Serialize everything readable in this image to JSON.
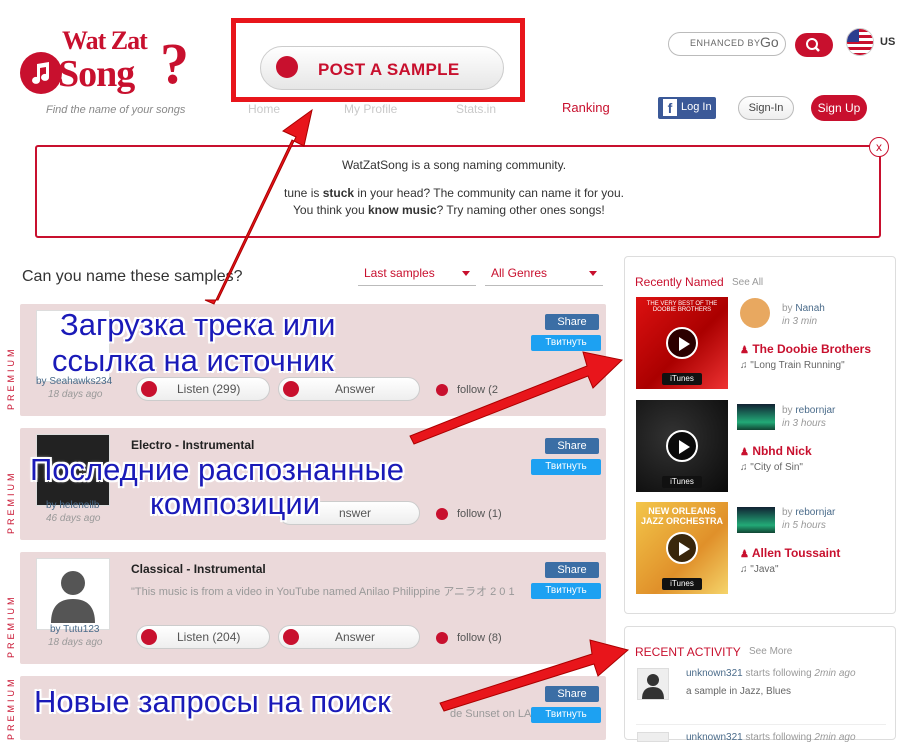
{
  "header": {
    "logo_line1": "Wat Zat",
    "logo_line2": "Song",
    "logo_q": "?",
    "tagline": "Find the name of your songs",
    "post_sample": "POST A SAMPLE",
    "nav": [
      "Home",
      "My Profile",
      "Stats.in"
    ],
    "ranking": "Ranking",
    "search_placeholder": "ENHANCED BY",
    "search_brand": "Go",
    "country": "US",
    "fb_login": "Log In",
    "sign_in": "Sign-In",
    "sign_up": "Sign Up"
  },
  "banner": {
    "line1": "WatZatSong is a song naming community.",
    "line2_pre": "tune is ",
    "line2_bold": "stuck",
    "line2_post": " in your head? The community can name it for you.",
    "line3_pre": "You think you ",
    "line3_bold": "know music",
    "line3_post": "? Try naming other ones songs!",
    "close": "x"
  },
  "section": {
    "title": "Can you name these samples?",
    "filter_samples": "Last samples",
    "filter_genres": "All Genres"
  },
  "premium_label": "PREMIUM",
  "cards": [
    {
      "user": "Seahawks234",
      "ago": "18 days ago",
      "title": "",
      "desc": "",
      "listen": "Listen (299)",
      "answer": "Answer",
      "follow": "follow (2",
      "share": "Share",
      "tweet": "Твитнуть"
    },
    {
      "user": "heleneilb",
      "ago": "46 days ago",
      "title": "Electro - Instrumental",
      "desc": "",
      "listen": "",
      "answer": "nswer",
      "follow": "follow (1)",
      "share": "Share",
      "tweet": "Твитнуть"
    },
    {
      "user": "Tutu123",
      "ago": "18 days ago",
      "title": "Classical - Instrumental",
      "desc": "\"This music is from a video in YouTube named Anilao Philippine アニラオ 2 0 1",
      "listen": "Listen (204)",
      "answer": "Answer",
      "follow": "follow (8)",
      "share": "Share",
      "tweet": "Твитнуть"
    },
    {
      "user": "",
      "ago": "",
      "title": "",
      "desc": "de Sunset on LA",
      "listen": "",
      "answer": "",
      "follow": "",
      "share": "Share",
      "tweet": "Твитнуть"
    }
  ],
  "sidebar": {
    "recent_title": "Recently Named",
    "recent_see": "See All",
    "itunes": "iTunes",
    "named": [
      {
        "by_label": "by",
        "user": "Nanah",
        "time": "in 3 min",
        "artist": "The Doobie Brothers",
        "song": "\"Long Train Running\"",
        "cover_text": "THE VERY BEST OF THE DOOBIE BROTHERS"
      },
      {
        "by_label": "by",
        "user": "rebornjar",
        "time": "in 3 hours",
        "artist": "Nbhd Nick",
        "song": "\"City of Sin\"",
        "cover_text": ""
      },
      {
        "by_label": "by",
        "user": "rebornjar",
        "time": "in 5 hours",
        "artist": "Allen Toussaint",
        "song": "\"Java\"",
        "cover_text": "NEW ORLEANS JAZZ ORCHESTRA"
      }
    ],
    "activity_title": "RECENT ACTIVITY",
    "activity_see": "See More",
    "activity": [
      {
        "user": "unknown321",
        "action": "starts following",
        "time": "2min ago",
        "detail": "a sample in Jazz, Blues"
      },
      {
        "user": "unknown321",
        "action": "starts following",
        "time": "2min ago",
        "detail": ""
      }
    ]
  },
  "annotations": {
    "a1_line1": "Загрузка трека или",
    "a1_line2": "ссылка на источник",
    "a2_line1": "Последние распознанные",
    "a2_line2": "композиции",
    "a3": "Новые запросы на поиск"
  },
  "colors": {
    "brand": "#c8102e",
    "highlight": "#e8151b",
    "annotation": "#1a1ab8",
    "card_bg": "#ebd9da"
  }
}
